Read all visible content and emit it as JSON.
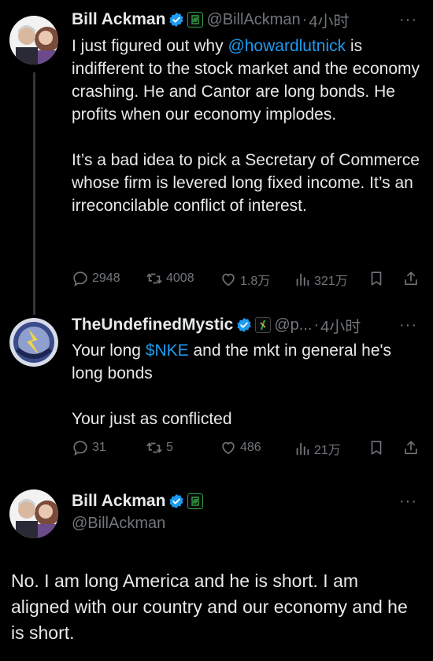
{
  "tweets": [
    {
      "name": "Bill Ackman",
      "handle": "@BillAckman",
      "dot": "·",
      "time": "4小时",
      "more": "···",
      "body_parts": {
        "p1_a": "I just figured out why ",
        "p1_mention": "@howardlutnick",
        "p1_b": " is indifferent to the stock market and the economy crashing. He and Cantor are long bonds. He profits when our economy implodes.",
        "p2": "It’s a bad idea to pick a Secretary of Commerce whose firm is levered long fixed income. It’s an irreconcilable conflict of interest."
      },
      "stats": {
        "replies": "2948",
        "retweets": "4008",
        "likes": "1.8万",
        "views": "321万"
      }
    },
    {
      "name": "TheUndefinedMystic",
      "handle": "@p...",
      "dot": "·",
      "time": "4小时",
      "more": "···",
      "body_parts": {
        "p1_a": "Your long ",
        "p1_cashtag": "$NKE",
        "p1_b": " and the mkt in general he's long bonds",
        "p2": "Your just as conflicted"
      },
      "stats": {
        "replies": "31",
        "retweets": "5",
        "likes": "486",
        "views": "21万"
      }
    }
  ],
  "main_tweet": {
    "name": "Bill Ackman",
    "handle": "@BillAckman",
    "more": "···",
    "text": "No. I am long America and he is short. I am aligned with our country and our economy and he is short."
  },
  "icons": {
    "reply": "reply-icon",
    "retweet": "retweet-icon",
    "like": "heart-icon",
    "views": "views-icon",
    "bookmark": "bookmark-icon",
    "share": "share-icon",
    "verified": "verified-badge-icon",
    "affiliation": "affiliation-badge-icon"
  },
  "colors": {
    "background": "#000000",
    "text": "#e7e9ea",
    "muted": "#71767b",
    "link": "#1d9bf0",
    "verified": "#1d9bf0"
  }
}
